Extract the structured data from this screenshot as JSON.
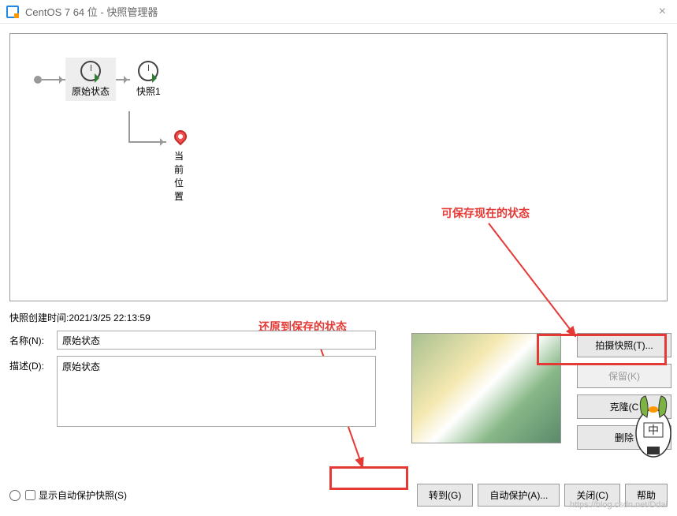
{
  "titlebar": {
    "title": "CentOS 7 64 位 - 快照管理器"
  },
  "tree": {
    "node1": "原始状态",
    "node2": "快照1",
    "current": "当前位置"
  },
  "annotations": {
    "save_current": "可保存现在的状态",
    "restore": "还原到保存的状态"
  },
  "details": {
    "created_label": "快照创建时间:2021/3/25 22:13:59",
    "name_label": "名称(N):",
    "name_value": "原始状态",
    "desc_label": "描述(D):",
    "desc_value": "原始状态"
  },
  "buttons": {
    "take_snapshot": "拍摄快照(T)...",
    "keep": "保留(K)",
    "clone": "克隆(C",
    "delete": "删除"
  },
  "footer": {
    "show_auto": "显示自动保护快照(S)",
    "goto": "转到(G)",
    "auto_protect": "自动保护(A)...",
    "close": "关闭(C)",
    "help": "帮助"
  },
  "mascot": {
    "char": "中"
  },
  "watermark": "https://blog.csdn.net/Ddai"
}
